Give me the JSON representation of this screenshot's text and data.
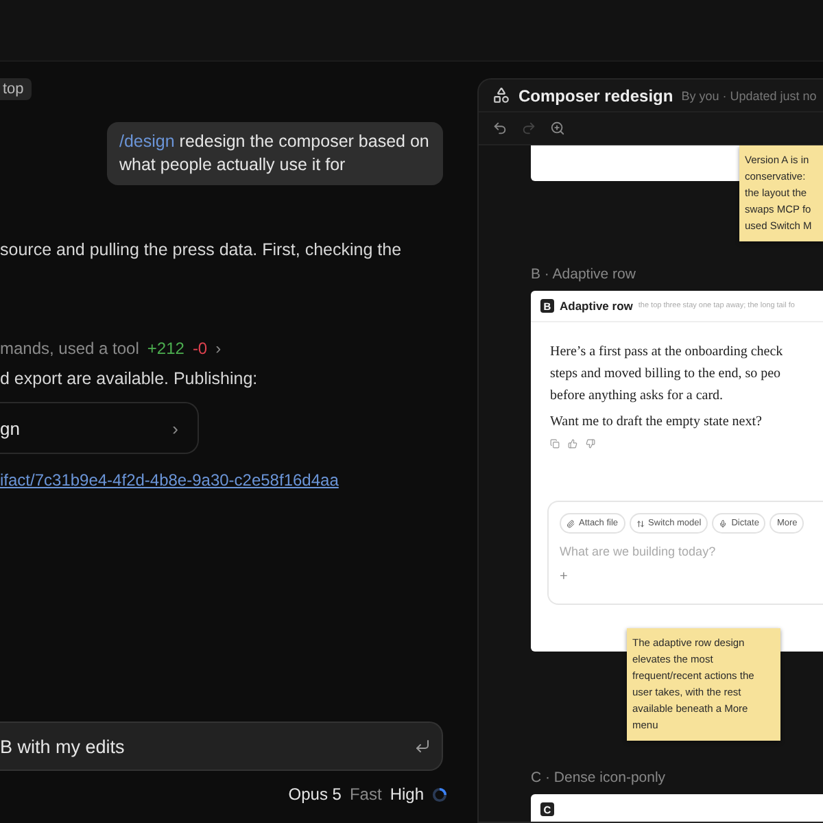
{
  "top_chip": "top",
  "user_message": {
    "command": "/design",
    "text": "redesign the composer based on what people actually use it for"
  },
  "assistant": {
    "line_1": "source and pulling the press data. First, checking the",
    "tool_summary": {
      "text": "mands, used a tool",
      "added": "+212",
      "removed": "-0",
      "chevron": "›"
    },
    "line_2": "d export are available. Publishing:",
    "artifact_card": {
      "title": "gn",
      "chevron": "›"
    },
    "link": "ifact/7c31b9e4-4f2d-4b8e-9a30-c2e58f16d4aa"
  },
  "composer": {
    "value": "B with my edits"
  },
  "model_bar": {
    "model": "Opus 5",
    "mode": "Fast",
    "effort": "High"
  },
  "panel": {
    "title": "Composer redesign",
    "meta": "By you · Updated just no",
    "sticky_top": [
      "Version A is in",
      "conservative:",
      "the layout the",
      "swaps MCP fo",
      "used Switch M"
    ],
    "section_b": {
      "label": "B · Adaptive row",
      "badge": "B",
      "name": "Adaptive row",
      "subtitle": "the top three stay one tap away; the long tail fo",
      "body": [
        "Here’s a first pass at the onboarding check",
        "steps and moved billing to the end, so peo",
        "before anything asks for a card."
      ],
      "question": "Want me to draft the empty state next?",
      "chips": [
        "Attach file",
        "Switch model",
        "Dictate",
        "More"
      ],
      "placeholder": "What are we building today?",
      "plus": "+"
    },
    "sticky_b": "The adaptive row design elevates the most frequent/recent actions the user takes, with the rest available beneath a More menu",
    "section_c": {
      "label": "C · Dense icon-ponly",
      "badge": "C"
    }
  }
}
